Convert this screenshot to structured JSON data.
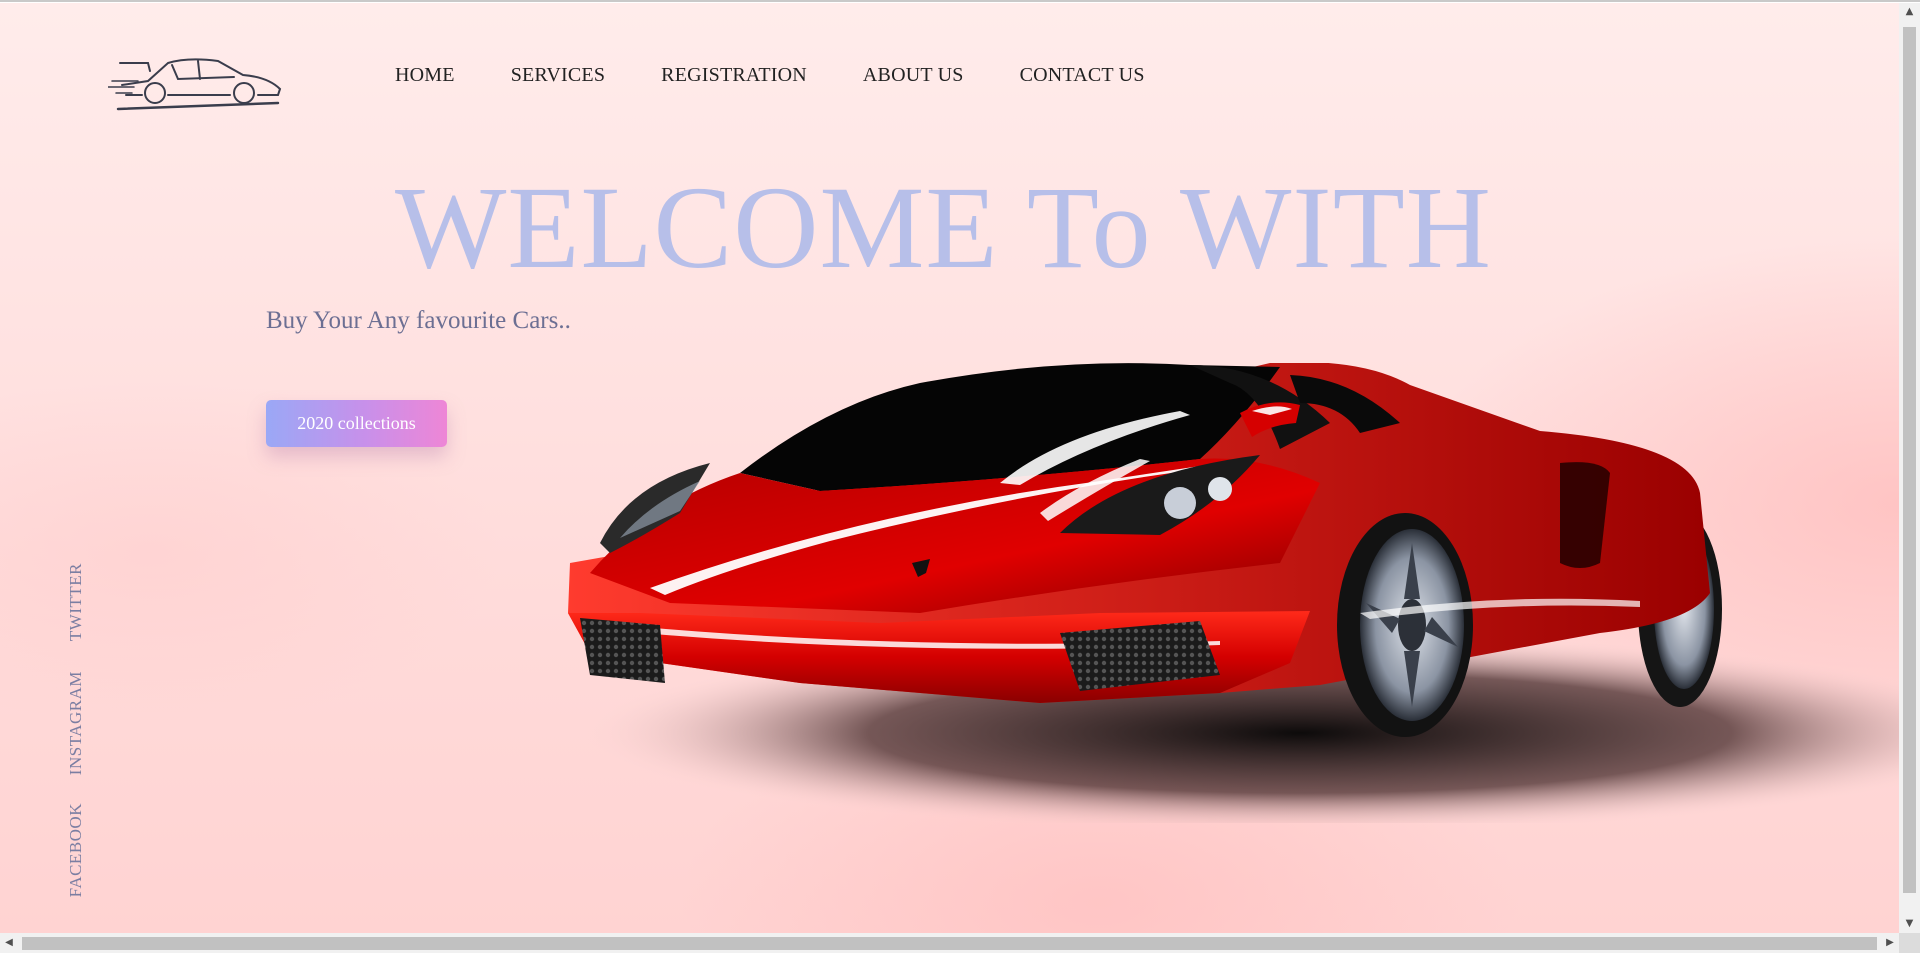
{
  "nav": {
    "items": [
      {
        "label": "HOME"
      },
      {
        "label": "SERVICES"
      },
      {
        "label": "REGISTRATION"
      },
      {
        "label": "ABOUT US"
      },
      {
        "label": "CONTACT US"
      }
    ]
  },
  "hero": {
    "title": "WELCOME To WITH",
    "subtitle": "Buy Your Any favourite Cars..",
    "cta_label": "2020 collections"
  },
  "social": {
    "twitter": "TWITTER",
    "instagram": "INSTAGRAM",
    "facebook": "FACEBOOK"
  },
  "icons": {
    "logo": "sports-car-outline-logo",
    "hero_image": "red-sports-car",
    "scroll_up": "arrow-up-icon",
    "scroll_down": "arrow-down-icon",
    "scroll_left": "arrow-left-icon",
    "scroll_right": "arrow-right-icon"
  },
  "colors": {
    "title": "#b7bfe9",
    "subtitle": "#6c6f93",
    "nav_text": "#222222",
    "cta_gradient_start": "#9aa8f6",
    "cta_gradient_end": "#ee86d6",
    "car_body": "#e00000"
  }
}
